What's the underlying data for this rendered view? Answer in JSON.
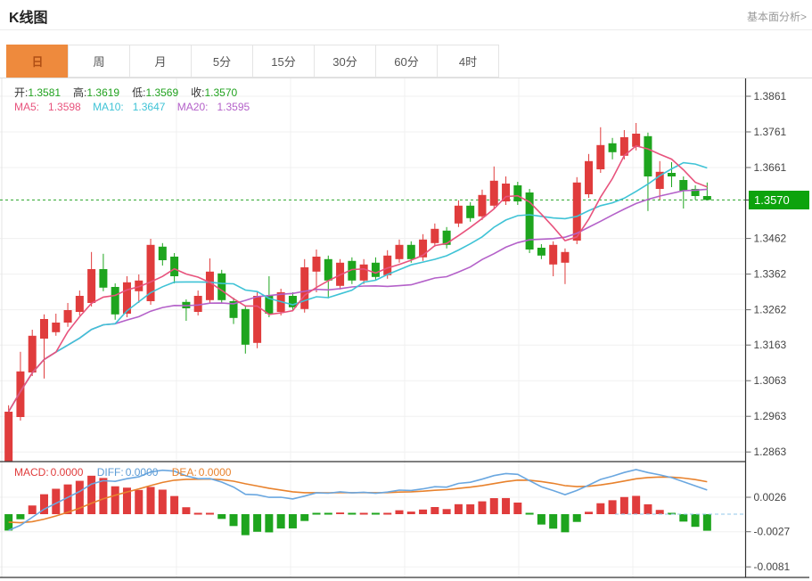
{
  "header": {
    "title": "K线图",
    "link": "基本面分析>"
  },
  "tabs": {
    "items": [
      "日",
      "周",
      "月",
      "5分",
      "15分",
      "30分",
      "60分",
      "4时"
    ],
    "selected": "日",
    "selected_index": 0
  },
  "legend": {
    "ohlc": [
      {
        "label": "开:",
        "value": "1.3581"
      },
      {
        "label": "高:",
        "value": "1.3619"
      },
      {
        "label": "低:",
        "value": "1.3569"
      },
      {
        "label": "收:",
        "value": "1.3570"
      }
    ],
    "ma": [
      {
        "label": "MA5:",
        "value": "1.3598",
        "color": "#e8537d"
      },
      {
        "label": "MA10:",
        "value": "1.3647",
        "color": "#3fc3d6"
      },
      {
        "label": "MA20:",
        "value": "1.3595",
        "color": "#b461c9"
      }
    ]
  },
  "macd_legend": [
    {
      "label": "MACD:",
      "value": "0.0000",
      "color": "#e03c3c"
    },
    {
      "label": "DIFF:",
      "value": "0.0000",
      "color": "#5b9bd5"
    },
    {
      "label": "DEA:",
      "value": "0.0000",
      "color": "#e8822d"
    }
  ],
  "price_badge": "1.3570",
  "colors": {
    "up_candle": "#e03c3c",
    "down_candle": "#1ea51e",
    "ma5": "#e8537d",
    "ma10": "#3fc3d6",
    "ma20": "#b461c9",
    "diff_line": "#6aa7e0",
    "dea_line": "#e8822d",
    "current_price_line": "#2aa52a",
    "badge_bg": "#0da30d",
    "tab_selected_bg": "#ee8a3d",
    "grid": "#f0f0f0",
    "axis": "#333333"
  },
  "chart_data": {
    "type": "candlestick+macd",
    "note": "Daily K-line; red = up (Chinese convention), green = down. Candles listed oldest to newest as [open, high, low, close].",
    "main": {
      "current_price": 1.357,
      "y_axis_ticks": [
        "1.3861",
        "1.3761",
        "1.3661",
        "1.3462",
        "1.3362",
        "1.3262",
        "1.3163",
        "1.3063",
        "1.2963",
        "1.2863"
      ],
      "candles": [
        [
          1.2836,
          1.2994,
          1.2831,
          1.2976
        ],
        [
          1.2961,
          1.3144,
          1.2951,
          1.3089
        ],
        [
          1.3086,
          1.3206,
          1.3076,
          1.3189
        ],
        [
          1.3181,
          1.3249,
          1.3069,
          1.3236
        ],
        [
          1.3199,
          1.3251,
          1.3189,
          1.3226
        ],
        [
          1.3226,
          1.3281,
          1.3214,
          1.3261
        ],
        [
          1.3256,
          1.3316,
          1.3246,
          1.3301
        ],
        [
          1.3281,
          1.3424,
          1.3271,
          1.3376
        ],
        [
          1.3376,
          1.3419,
          1.3314,
          1.3324
        ],
        [
          1.3326,
          1.3336,
          1.3234,
          1.3249
        ],
        [
          1.3251,
          1.3356,
          1.3241,
          1.3339
        ],
        [
          1.3314,
          1.3361,
          1.3281,
          1.3344
        ],
        [
          1.3286,
          1.3461,
          1.3276,
          1.3444
        ],
        [
          1.3439,
          1.3449,
          1.3386,
          1.3401
        ],
        [
          1.3411,
          1.3421,
          1.3336,
          1.3356
        ],
        [
          1.3284,
          1.3291,
          1.3231,
          1.3266
        ],
        [
          1.3256,
          1.3316,
          1.3246,
          1.3301
        ],
        [
          1.3289,
          1.3406,
          1.3279,
          1.3369
        ],
        [
          1.3364,
          1.3374,
          1.3279,
          1.3289
        ],
        [
          1.3286,
          1.3296,
          1.3222,
          1.3239
        ],
        [
          1.3264,
          1.3274,
          1.3139,
          1.3164
        ],
        [
          1.3169,
          1.3311,
          1.3154,
          1.3301
        ],
        [
          1.3301,
          1.3356,
          1.3241,
          1.3251
        ],
        [
          1.3256,
          1.3321,
          1.3246,
          1.3311
        ],
        [
          1.3301,
          1.3311,
          1.3259,
          1.3269
        ],
        [
          1.3264,
          1.3404,
          1.3254,
          1.3381
        ],
        [
          1.3369,
          1.3431,
          1.3311,
          1.3411
        ],
        [
          1.3404,
          1.3414,
          1.3294,
          1.3344
        ],
        [
          1.3329,
          1.3404,
          1.3319,
          1.3394
        ],
        [
          1.3399,
          1.3409,
          1.3334,
          1.3344
        ],
        [
          1.3344,
          1.3404,
          1.3334,
          1.3389
        ],
        [
          1.3394,
          1.3409,
          1.3344,
          1.3354
        ],
        [
          1.3359,
          1.3429,
          1.3349,
          1.3414
        ],
        [
          1.3404,
          1.3459,
          1.3394,
          1.3444
        ],
        [
          1.3444,
          1.3454,
          1.3394,
          1.3404
        ],
        [
          1.3409,
          1.3474,
          1.3399,
          1.3459
        ],
        [
          1.3449,
          1.3504,
          1.3439,
          1.3489
        ],
        [
          1.3484,
          1.3494,
          1.3434,
          1.3444
        ],
        [
          1.3504,
          1.3569,
          1.3494,
          1.3554
        ],
        [
          1.3554,
          1.3564,
          1.3509,
          1.3519
        ],
        [
          1.3524,
          1.3599,
          1.3514,
          1.3584
        ],
        [
          1.3554,
          1.3664,
          1.3544,
          1.3624
        ],
        [
          1.3566,
          1.3636,
          1.3556,
          1.3616
        ],
        [
          1.3611,
          1.3621,
          1.3556,
          1.3566
        ],
        [
          1.3591,
          1.3601,
          1.3421,
          1.3431
        ],
        [
          1.3436,
          1.3446,
          1.3404,
          1.3414
        ],
        [
          1.3389,
          1.3454,
          1.3356,
          1.3444
        ],
        [
          1.3394,
          1.3434,
          1.3334,
          1.3424
        ],
        [
          1.3456,
          1.3634,
          1.3446,
          1.3619
        ],
        [
          1.3586,
          1.3699,
          1.3576,
          1.3679
        ],
        [
          1.3656,
          1.3774,
          1.3646,
          1.3724
        ],
        [
          1.3729,
          1.3744,
          1.3684,
          1.3704
        ],
        [
          1.3694,
          1.3766,
          1.3684,
          1.3746
        ],
        [
          1.3719,
          1.3786,
          1.3709,
          1.3756
        ],
        [
          1.3749,
          1.3759,
          1.3539,
          1.3636
        ],
        [
          1.3601,
          1.3679,
          1.3571,
          1.3649
        ],
        [
          1.3646,
          1.3676,
          1.3606,
          1.3636
        ],
        [
          1.3626,
          1.3636,
          1.3546,
          1.3596
        ],
        [
          1.3601,
          1.3611,
          1.3571,
          1.3581
        ],
        [
          1.3581,
          1.3619,
          1.3569,
          1.357
        ]
      ],
      "moving_averages": {
        "MA5": 1.3598,
        "MA10": 1.3647,
        "MA20": 1.3595
      }
    },
    "macd": {
      "y_axis_ticks": [
        "0.0026",
        "-0.0027",
        "-0.0081"
      ],
      "MACD": 0.0,
      "DIFF": 0.0,
      "DEA": 0.0
    }
  }
}
